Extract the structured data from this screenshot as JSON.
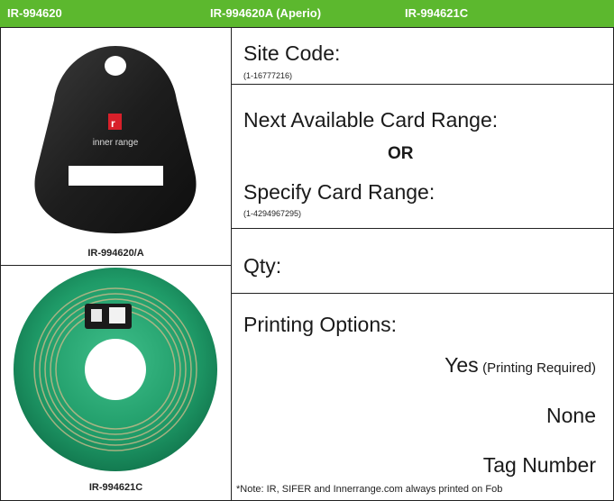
{
  "header": {
    "col1": "IR-994620",
    "col2": "IR-994620A (Aperio)",
    "col3": "IR-994621C",
    "bg_color": "#5cb82e"
  },
  "left": {
    "fob_brand_text": "inner range",
    "fob_caption": "IR-994620/A",
    "tag_caption": "IR-994621C"
  },
  "right": {
    "site_code_label": "Site Code:",
    "site_code_range": "(1-16777216)",
    "next_available_label": "Next Available Card Range:",
    "or_text": "OR",
    "specify_label": "Specify Card Range:",
    "specify_range": "(1-4294967295)",
    "qty_label": "Qty:",
    "printing_label": "Printing Options:",
    "option_yes": "Yes",
    "option_yes_note": "(Printing Required)",
    "option_none": "None",
    "option_tag": "Tag Number",
    "note": "*Note: IR, SIFER and Innerrange.com always printed on Fob"
  }
}
